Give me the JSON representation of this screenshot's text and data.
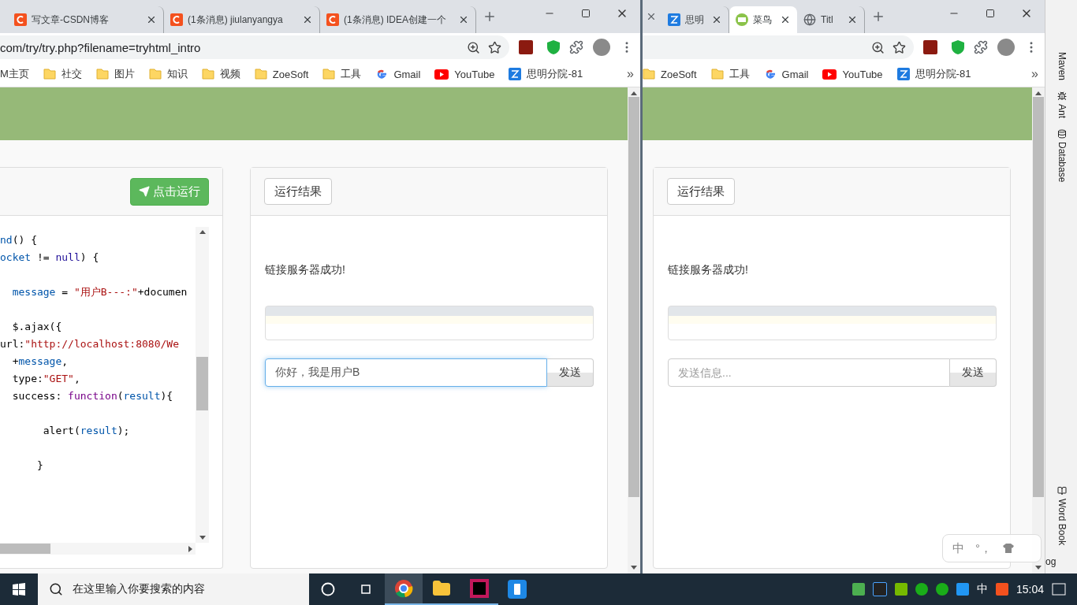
{
  "left_browser": {
    "tabs": [
      {
        "title": "写文章-CSDN博客",
        "selected": false
      },
      {
        "title": "(1条消息) jiulanyangya",
        "selected": false
      },
      {
        "title": "(1条消息) IDEA创建一个",
        "selected": false
      }
    ],
    "address": "com/try/try.php?filename=tryhtml_intro",
    "bookmarks": [
      {
        "label": "M主页",
        "kind": "plain"
      },
      {
        "label": "社交",
        "kind": "folder"
      },
      {
        "label": "图片",
        "kind": "folder"
      },
      {
        "label": "知识",
        "kind": "folder"
      },
      {
        "label": "视频",
        "kind": "folder"
      },
      {
        "label": "ZoeSoft",
        "kind": "folder"
      },
      {
        "label": "工具",
        "kind": "folder"
      },
      {
        "label": "Gmail",
        "kind": "google"
      },
      {
        "label": "YouTube",
        "kind": "youtube"
      },
      {
        "label": "思明分院-81",
        "kind": "site"
      }
    ],
    "more_bookmarks": "»",
    "editor": {
      "run_button": "点击运行",
      "blocks": [
        [
          {
            "tokens": [
              {
                "color": "#0055aa",
                "s": "nd"
              },
              {
                "s": "() {"
              }
            ]
          },
          {
            "tokens": [
              {
                "color": "#0055aa",
                "s": "ocket"
              },
              {
                "s": " != "
              },
              {
                "color": "#221199",
                "s": "null"
              },
              {
                "s": ") {"
              }
            ]
          }
        ],
        [
          {
            "tokens": [
              {
                "color": "#0055aa",
                "s": "  message"
              },
              {
                "s": " = "
              },
              {
                "color": "#aa1111",
                "s": "\"用户B---:\""
              },
              {
                "s": "+documen"
              }
            ]
          }
        ],
        [
          {
            "tokens": [
              {
                "s": "  $.ajax({"
              }
            ]
          },
          {
            "tokens": [
              {
                "s": "url:"
              },
              {
                "color": "#aa1111",
                "s": "\"http://localhost:8080/We"
              }
            ]
          },
          {
            "tokens": [
              {
                "s": "  +"
              },
              {
                "color": "#0055aa",
                "s": "message"
              },
              {
                "s": ","
              }
            ]
          },
          {
            "tokens": [
              {
                "s": "  type:"
              },
              {
                "color": "#aa1111",
                "s": "\"GET\""
              },
              {
                "s": ","
              }
            ]
          },
          {
            "tokens": [
              {
                "s": "  success: "
              },
              {
                "color": "#770088",
                "s": "function"
              },
              {
                "s": "("
              },
              {
                "color": "#0055aa",
                "s": "result"
              },
              {
                "s": "){"
              }
            ]
          }
        ],
        [
          {
            "tokens": [
              {
                "s": "       alert("
              },
              {
                "color": "#0055aa",
                "s": "result"
              },
              {
                "s": ");"
              }
            ]
          }
        ],
        [
          {
            "tokens": [
              {
                "s": "      }"
              }
            ]
          }
        ]
      ]
    },
    "result": {
      "button": "运行结果",
      "status": "链接服务器成功!",
      "message_value": "你好，我是用户B",
      "focused": true,
      "send": "发送"
    }
  },
  "right_browser": {
    "tabs": [
      {
        "title": "思明",
        "selected": false
      },
      {
        "title": "菜鸟",
        "selected": true
      },
      {
        "title": "Titl",
        "selected": false
      }
    ],
    "bookmarks": [
      {
        "label": "ZoeSoft",
        "kind": "folder"
      },
      {
        "label": "工具",
        "kind": "folder"
      },
      {
        "label": "Gmail",
        "kind": "google"
      },
      {
        "label": "YouTube",
        "kind": "youtube"
      },
      {
        "label": "思明分院-81",
        "kind": "site"
      }
    ],
    "more_bookmarks": "»",
    "result": {
      "button": "运行结果",
      "status": "链接服务器成功!",
      "message_placeholder": "发送信息...",
      "focused": false,
      "send": "发送"
    },
    "ime_bar": {
      "mode": "中",
      "punct": "°，"
    }
  },
  "ide_strip": {
    "tools": [
      "Maven",
      "Ant",
      "Database"
    ],
    "bottom_tools": [
      "Word Book"
    ],
    "log": "og"
  },
  "taskbar": {
    "search_placeholder": "在这里输入你要搜索的内容",
    "ime": "中",
    "time": "15:04"
  }
}
